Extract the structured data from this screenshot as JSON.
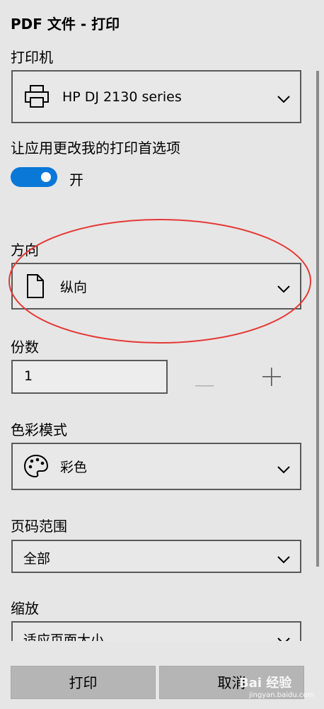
{
  "header": {
    "title": "PDF 文件 - 打印"
  },
  "printer": {
    "label": "打印机",
    "selected": "HP DJ 2130 series",
    "icon": "printer-icon"
  },
  "app_prefs": {
    "label": "让应用更改我的打印首选项",
    "toggle_state": "开",
    "toggle_on": true,
    "accent": "#0a78d7"
  },
  "orientation": {
    "label": "方向",
    "selected": "纵向",
    "icon": "page-portrait-icon",
    "annotation_color": "#e53935"
  },
  "copies": {
    "label": "份数",
    "value": "1",
    "decrement": "—",
    "increment": "+"
  },
  "color_mode": {
    "label": "色彩模式",
    "selected": "彩色",
    "icon": "palette-icon"
  },
  "page_range": {
    "label": "页码范围",
    "selected": "全部"
  },
  "scale": {
    "label": "缩放",
    "selected": "适应页面大小"
  },
  "actions": {
    "print": "打印",
    "cancel": "取消"
  },
  "watermark": {
    "text": "Bai 经验",
    "sub": "jingyan.baidu.com"
  }
}
